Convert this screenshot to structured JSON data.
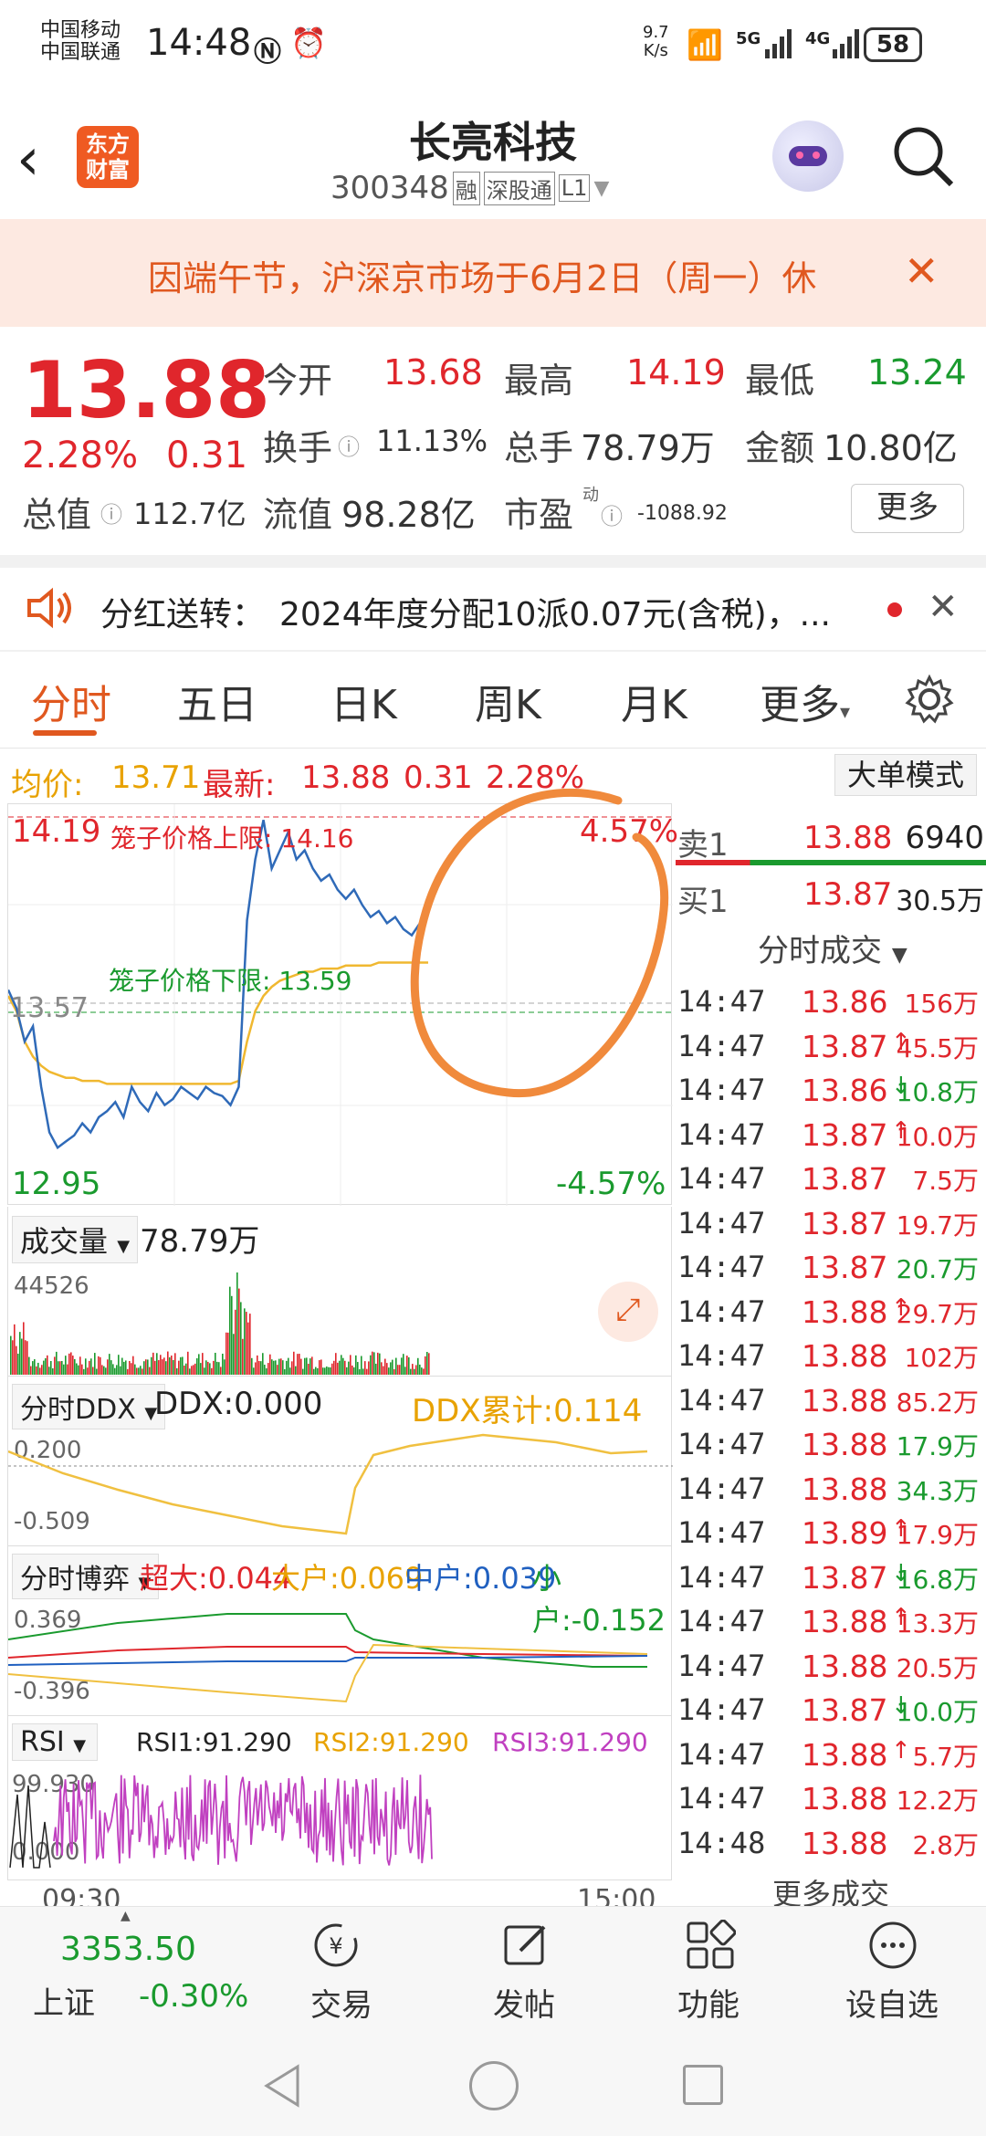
{
  "status": {
    "carrier1": "中国移动",
    "carrier2": "中国联通",
    "time": "14:48",
    "speed_top": "9.7",
    "speed_unit": "K/s",
    "net1": "5G",
    "net2": "4G",
    "battery": "58"
  },
  "header": {
    "logo_line1": "东方",
    "logo_line2": "财富",
    "title": "长亮科技",
    "code": "300348",
    "tag1": "融",
    "tag2": "深股通",
    "tag3": "L1"
  },
  "notice": {
    "text": "因端午节，沪深京市场于6月2日（周一）休"
  },
  "quote": {
    "price": "13.88",
    "change_pct": "2.28%",
    "change": "0.31",
    "open_label": "今开",
    "open": "13.68",
    "high_label": "最高",
    "high": "14.19",
    "low_label": "最低",
    "low": "13.24",
    "turnover_label": "换手",
    "turnover": "11.13%",
    "volume_label": "总手",
    "volume": "78.79万",
    "amount_label": "金额",
    "amount": "10.80亿",
    "mcap_label": "总值",
    "mcap": "112.7亿",
    "float_label": "流值",
    "float": "98.28亿",
    "pe_label": "市盈",
    "pe_sup": "动",
    "pe": "-1088.92",
    "more": "更多"
  },
  "dividend": {
    "label": "分红送转：",
    "text": "2024年度分配10派0.07元(含税)，..."
  },
  "tabs": [
    "分时",
    "五日",
    "日K",
    "周K",
    "月K",
    "更多"
  ],
  "chart_info": {
    "avg_label": "均价:",
    "avg": "13.71",
    "last_label": "最新:",
    "last": "13.88",
    "chg": "0.31",
    "pct": "2.28%",
    "mode_button": "大单模式"
  },
  "chart_data": {
    "type": "line",
    "y_high_label": "14.19",
    "y_low_label": "12.95",
    "y_mid_label": "13.57",
    "pct_high": "4.57%",
    "pct_low": "-4.57%",
    "upper_limit_label": "笼子价格上限: 14.16",
    "lower_limit_label": "笼子价格下限: 13.59",
    "x_start": "09:30",
    "x_end": "15:00",
    "ylim": [
      12.95,
      14.19
    ],
    "prev_close": 13.57,
    "price_series": [
      13.62,
      13.56,
      13.45,
      13.5,
      13.3,
      13.15,
      13.1,
      13.12,
      13.14,
      13.18,
      13.15,
      13.2,
      13.22,
      13.25,
      13.2,
      13.3,
      13.25,
      13.22,
      13.28,
      13.24,
      13.26,
      13.3,
      13.28,
      13.26,
      13.3,
      13.28,
      13.27,
      13.24,
      13.3,
      13.85,
      14.05,
      14.18,
      14.02,
      14.08,
      14.14,
      14.05,
      14.08,
      14.02,
      13.98,
      14.0,
      13.95,
      13.92,
      13.95,
      13.9,
      13.86,
      13.88,
      13.84,
      13.86,
      13.82,
      13.8,
      13.84,
      13.88
    ],
    "avg_series": [
      13.6,
      13.55,
      13.45,
      13.4,
      13.37,
      13.35,
      13.34,
      13.33,
      13.33,
      13.32,
      13.32,
      13.32,
      13.31,
      13.31,
      13.31,
      13.31,
      13.31,
      13.31,
      13.31,
      13.31,
      13.31,
      13.31,
      13.31,
      13.31,
      13.31,
      13.31,
      13.31,
      13.31,
      13.32,
      13.45,
      13.55,
      13.6,
      13.63,
      13.65,
      13.66,
      13.67,
      13.68,
      13.68,
      13.69,
      13.69,
      13.69,
      13.7,
      13.7,
      13.7,
      13.7,
      13.71,
      13.71,
      13.71,
      13.71,
      13.71,
      13.71,
      13.71
    ]
  },
  "order_book": {
    "sell_label": "卖1",
    "sell_price": "13.88",
    "sell_vol": "6940",
    "buy_label": "买1",
    "buy_price": "13.87",
    "buy_vol": "30.5万",
    "trades_title": "分时成交",
    "more_trades": "更多成交"
  },
  "trades": [
    {
      "t": "14:47",
      "p": "13.86",
      "arrow": "",
      "v": "156万",
      "c": "red"
    },
    {
      "t": "14:47",
      "p": "13.87",
      "arrow": "↑",
      "v": "45.5万",
      "c": "red"
    },
    {
      "t": "14:47",
      "p": "13.86",
      "arrow": "↓",
      "v": "10.8万",
      "c": "green"
    },
    {
      "t": "14:47",
      "p": "13.87",
      "arrow": "↑",
      "v": "10.0万",
      "c": "red"
    },
    {
      "t": "14:47",
      "p": "13.87",
      "arrow": "",
      "v": "7.5万",
      "c": "red"
    },
    {
      "t": "14:47",
      "p": "13.87",
      "arrow": "",
      "v": "19.7万",
      "c": "red"
    },
    {
      "t": "14:47",
      "p": "13.87",
      "arrow": "",
      "v": "20.7万",
      "c": "green"
    },
    {
      "t": "14:47",
      "p": "13.88",
      "arrow": "↑",
      "v": "29.7万",
      "c": "red"
    },
    {
      "t": "14:47",
      "p": "13.88",
      "arrow": "",
      "v": "102万",
      "c": "red"
    },
    {
      "t": "14:47",
      "p": "13.88",
      "arrow": "",
      "v": "85.2万",
      "c": "red"
    },
    {
      "t": "14:47",
      "p": "13.88",
      "arrow": "",
      "v": "17.9万",
      "c": "green"
    },
    {
      "t": "14:47",
      "p": "13.88",
      "arrow": "",
      "v": "34.3万",
      "c": "green"
    },
    {
      "t": "14:47",
      "p": "13.89",
      "arrow": "↑",
      "v": "17.9万",
      "c": "red"
    },
    {
      "t": "14:47",
      "p": "13.87",
      "arrow": "↓",
      "v": "16.8万",
      "c": "green"
    },
    {
      "t": "14:47",
      "p": "13.88",
      "arrow": "↑",
      "v": "13.3万",
      "c": "red"
    },
    {
      "t": "14:47",
      "p": "13.88",
      "arrow": "",
      "v": "20.5万",
      "c": "red"
    },
    {
      "t": "14:47",
      "p": "13.87",
      "arrow": "↓",
      "v": "10.0万",
      "c": "green"
    },
    {
      "t": "14:47",
      "p": "13.88",
      "arrow": "↑",
      "v": "5.7万",
      "c": "red"
    },
    {
      "t": "14:47",
      "p": "13.88",
      "arrow": "",
      "v": "12.2万",
      "c": "red"
    },
    {
      "t": "14:48",
      "p": "13.88",
      "arrow": "",
      "v": "2.8万",
      "c": "red"
    }
  ],
  "volume_panel": {
    "selector": "成交量",
    "value": "78.79万",
    "max": "44526"
  },
  "ddx_panel": {
    "selector": "分时DDX",
    "ddx": "DDX:0.000",
    "ddx_sum": "DDX累计:0.114",
    "top": "0.200",
    "bottom": "-0.509"
  },
  "game_panel": {
    "selector": "分时博弈",
    "super": "超大:0.044",
    "large": "大户:0.069",
    "mid": "中户:0.039",
    "small": "小户:-0.152",
    "top": "0.369",
    "bottom": "-0.396"
  },
  "rsi_panel": {
    "selector": "RSI",
    "rsi1": "RSI1:91.290",
    "rsi2": "RSI2:91.290",
    "rsi3": "RSI3:91.290",
    "top": "99.930",
    "bottom": "0.000"
  },
  "bottom_nav": {
    "index_value": "3353.50",
    "index_name": "上证",
    "index_pct": "-0.30%",
    "trade": "交易",
    "post": "发帖",
    "func": "功能",
    "watch": "设自选"
  }
}
